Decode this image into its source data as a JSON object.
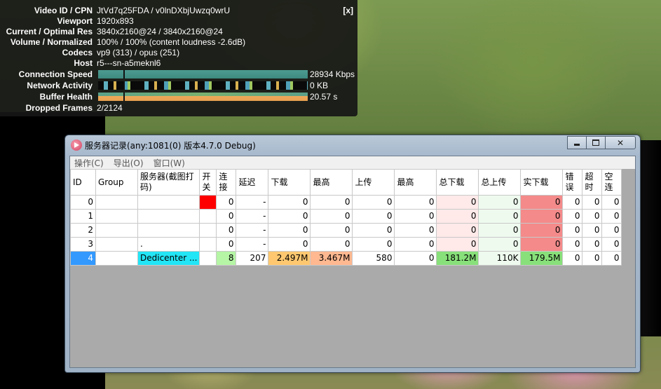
{
  "stats": {
    "close": "[x]",
    "rows": [
      {
        "label": "Video ID / CPN",
        "value": "JtVd7q25FDA / v0lnDXbjUwzq0wrU"
      },
      {
        "label": "Viewport",
        "value": "1920x893"
      },
      {
        "label": "Current / Optimal Res",
        "value": "3840x2160@24 / 3840x2160@24"
      },
      {
        "label": "Volume / Normalized",
        "value": "100% / 100% (content loudness -2.6dB)"
      },
      {
        "label": "Codecs",
        "value": "vp9 (313) / opus (251)"
      },
      {
        "label": "Host",
        "value": "r5---sn-a5meknl6"
      },
      {
        "label": "Connection Speed",
        "value": "28934 Kbps"
      },
      {
        "label": "Network Activity",
        "value": "0 KB"
      },
      {
        "label": "Buffer Health",
        "value": "20.57 s"
      },
      {
        "label": "Dropped Frames",
        "value": "2/2124"
      }
    ]
  },
  "window": {
    "title": "服务器记录(any:1081(0) 版本4.7.0 Debug)",
    "menu": [
      "操作(C)",
      "导出(O)",
      "窗口(W)"
    ],
    "columns": [
      "ID",
      "Group",
      "服务器(截图打码)",
      "开关",
      "连接",
      "延迟",
      "下载",
      "最高",
      "上传",
      "最高",
      "总下载",
      "总上传",
      "实下载",
      "错误",
      "超时",
      "空连"
    ],
    "rows": [
      {
        "id": "0",
        "group": "",
        "server": "",
        "conn": "0",
        "latency": "-",
        "down": "0",
        "down_max": "0",
        "up": "0",
        "up_max": "0",
        "total_down": "0",
        "total_up": "0",
        "real_down": "0",
        "err": "0",
        "timeout": "0",
        "empty": "0"
      },
      {
        "id": "1",
        "group": "",
        "server": "",
        "conn": "0",
        "latency": "-",
        "down": "0",
        "down_max": "0",
        "up": "0",
        "up_max": "0",
        "total_down": "0",
        "total_up": "0",
        "real_down": "0",
        "err": "0",
        "timeout": "0",
        "empty": "0"
      },
      {
        "id": "2",
        "group": "",
        "server": "",
        "conn": "0",
        "latency": "-",
        "down": "0",
        "down_max": "0",
        "up": "0",
        "up_max": "0",
        "total_down": "0",
        "total_up": "0",
        "real_down": "0",
        "err": "0",
        "timeout": "0",
        "empty": "0"
      },
      {
        "id": "3",
        "group": "",
        "server": ".",
        "conn": "0",
        "latency": "-",
        "down": "0",
        "down_max": "0",
        "up": "0",
        "up_max": "0",
        "total_down": "0",
        "total_up": "0",
        "real_down": "0",
        "err": "0",
        "timeout": "0",
        "empty": "0"
      },
      {
        "id": "4",
        "group": "",
        "server": "Dedicenter ...",
        "conn": "8",
        "latency": "207",
        "down": "2.497M",
        "down_max": "3.467M",
        "up": "580",
        "up_max": "0",
        "total_down": "181.2M",
        "total_up": "110K",
        "real_down": "179.5M",
        "err": "0",
        "timeout": "0",
        "empty": "0"
      }
    ]
  }
}
